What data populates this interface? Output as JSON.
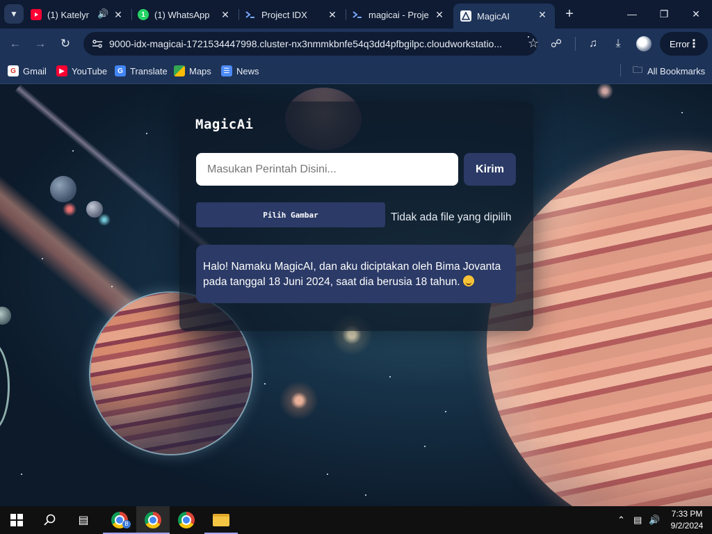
{
  "browser": {
    "tabs": [
      {
        "title": "(1) Katelyn",
        "favicon": "youtube-icon",
        "active": false
      },
      {
        "title": "(1) WhatsApp",
        "favicon": "whatsapp-icon",
        "active": false
      },
      {
        "title": "Project IDX",
        "favicon": "idx-icon",
        "active": false
      },
      {
        "title": "magicai - Proje",
        "favicon": "idx-icon",
        "active": false
      },
      {
        "title": "MagicAI",
        "favicon": "magicai-icon",
        "active": true
      }
    ],
    "address": "9000-idx-magicai-1721534447998.cluster-nx3nmmkbnfe54q3dd4pfbgilpc.cloudworkstatio...",
    "profile_status": "Error",
    "bookmarks": [
      {
        "label": "Gmail",
        "icon": "gmail-icon"
      },
      {
        "label": "YouTube",
        "icon": "youtube-icon"
      },
      {
        "label": "Translate",
        "icon": "translate-icon"
      },
      {
        "label": "Maps",
        "icon": "maps-icon"
      },
      {
        "label": "News",
        "icon": "news-icon"
      }
    ],
    "all_bookmarks": "All Bookmarks"
  },
  "app": {
    "title": "MagicAi",
    "prompt_placeholder": "Masukan Perintah Disini...",
    "prompt_value": "",
    "send_label": "Kirim",
    "file_button_label": "Pilih Gambar",
    "file_status": "Tidak ada file yang dipilih",
    "messages": [
      {
        "role": "assistant",
        "text": "Halo! Namaku MagicAI, dan aku diciptakan oleh Bima Jovanta pada tanggal 18 Juni 2024, saat dia berusia 18 tahun."
      }
    ]
  },
  "taskbar": {
    "time": "7:33 PM",
    "date": "9/2/2024",
    "chrome_badge": "B"
  },
  "colors": {
    "accent": "#2b3a66",
    "chrome_dark": "#0e1b33",
    "chrome_bar": "#1d3358"
  }
}
